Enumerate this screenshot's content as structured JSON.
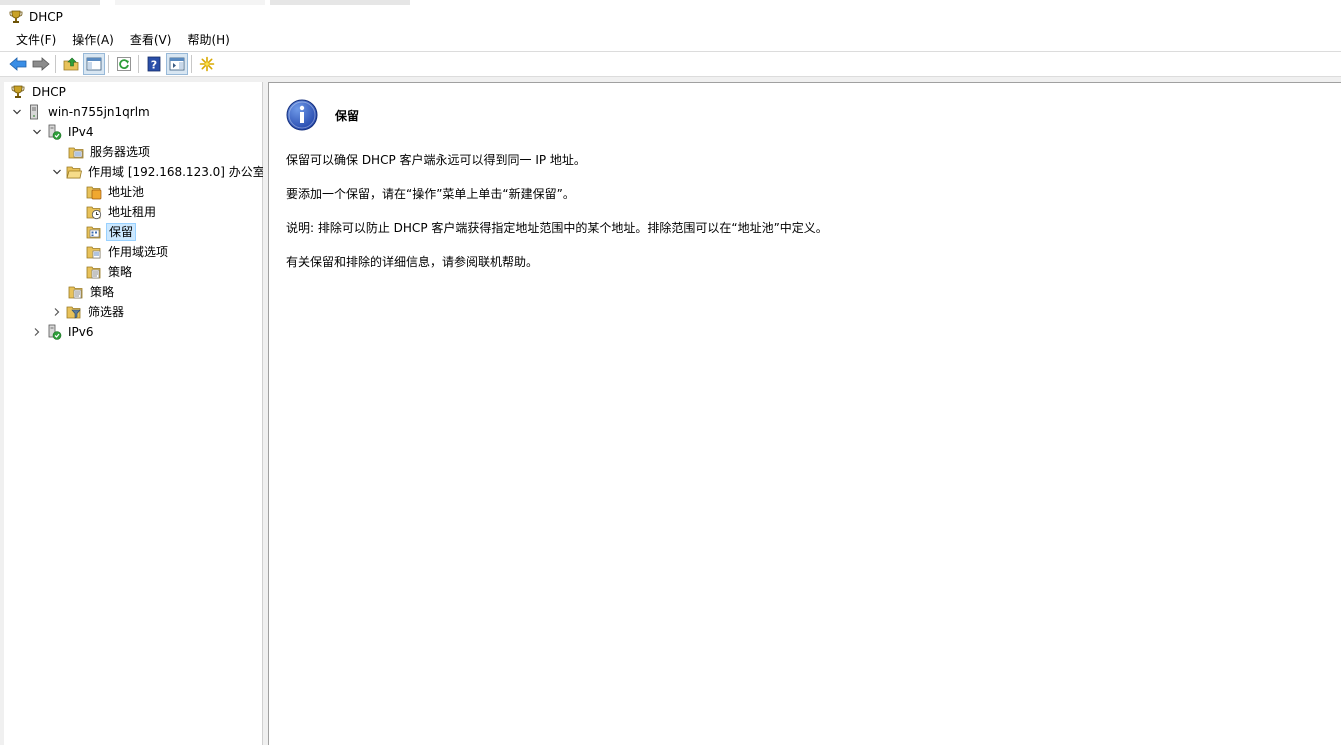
{
  "window": {
    "title": "DHCP"
  },
  "menu": [
    "文件(F)",
    "操作(A)",
    "查看(V)",
    "帮助(H)"
  ],
  "toolbar": [
    {
      "name": "back-button",
      "icon": "arrow-left-icon"
    },
    {
      "name": "forward-button",
      "icon": "arrow-right-icon"
    },
    {
      "name": "up-button",
      "icon": "folder-up-icon"
    },
    {
      "name": "show-hide-console-tree-button",
      "icon": "console-tree-icon"
    },
    {
      "name": "refresh-button",
      "icon": "refresh-icon"
    },
    {
      "name": "help-button",
      "icon": "help-icon"
    },
    {
      "name": "show-action-pane-button",
      "icon": "action-pane-icon"
    },
    {
      "name": "new-button",
      "icon": "star-new-icon"
    }
  ],
  "tree": {
    "root": "DHCP",
    "server": "win-n755jn1qrlm",
    "ipv4": "IPv4",
    "server_options": "服务器选项",
    "scope": "作用域 [192.168.123.0] 办公室",
    "address_pool": "地址池",
    "address_leases": "地址租用",
    "reservations": "保留",
    "scope_options": "作用域选项",
    "scope_policies": "策略",
    "policies": "策略",
    "filters": "筛选器",
    "ipv6": "IPv6"
  },
  "content": {
    "title": "保留",
    "p1": "保留可以确保 DHCP 客户端永远可以得到同一 IP 地址。",
    "p2": "要添加一个保留，请在“操作”菜单上单击“新建保留”。",
    "p3": "说明: 排除可以防止 DHCP 客户端获得指定地址范围中的某个地址。排除范围可以在“地址池”中定义。",
    "p4": "有关保留和排除的详细信息，请参阅联机帮助。"
  }
}
